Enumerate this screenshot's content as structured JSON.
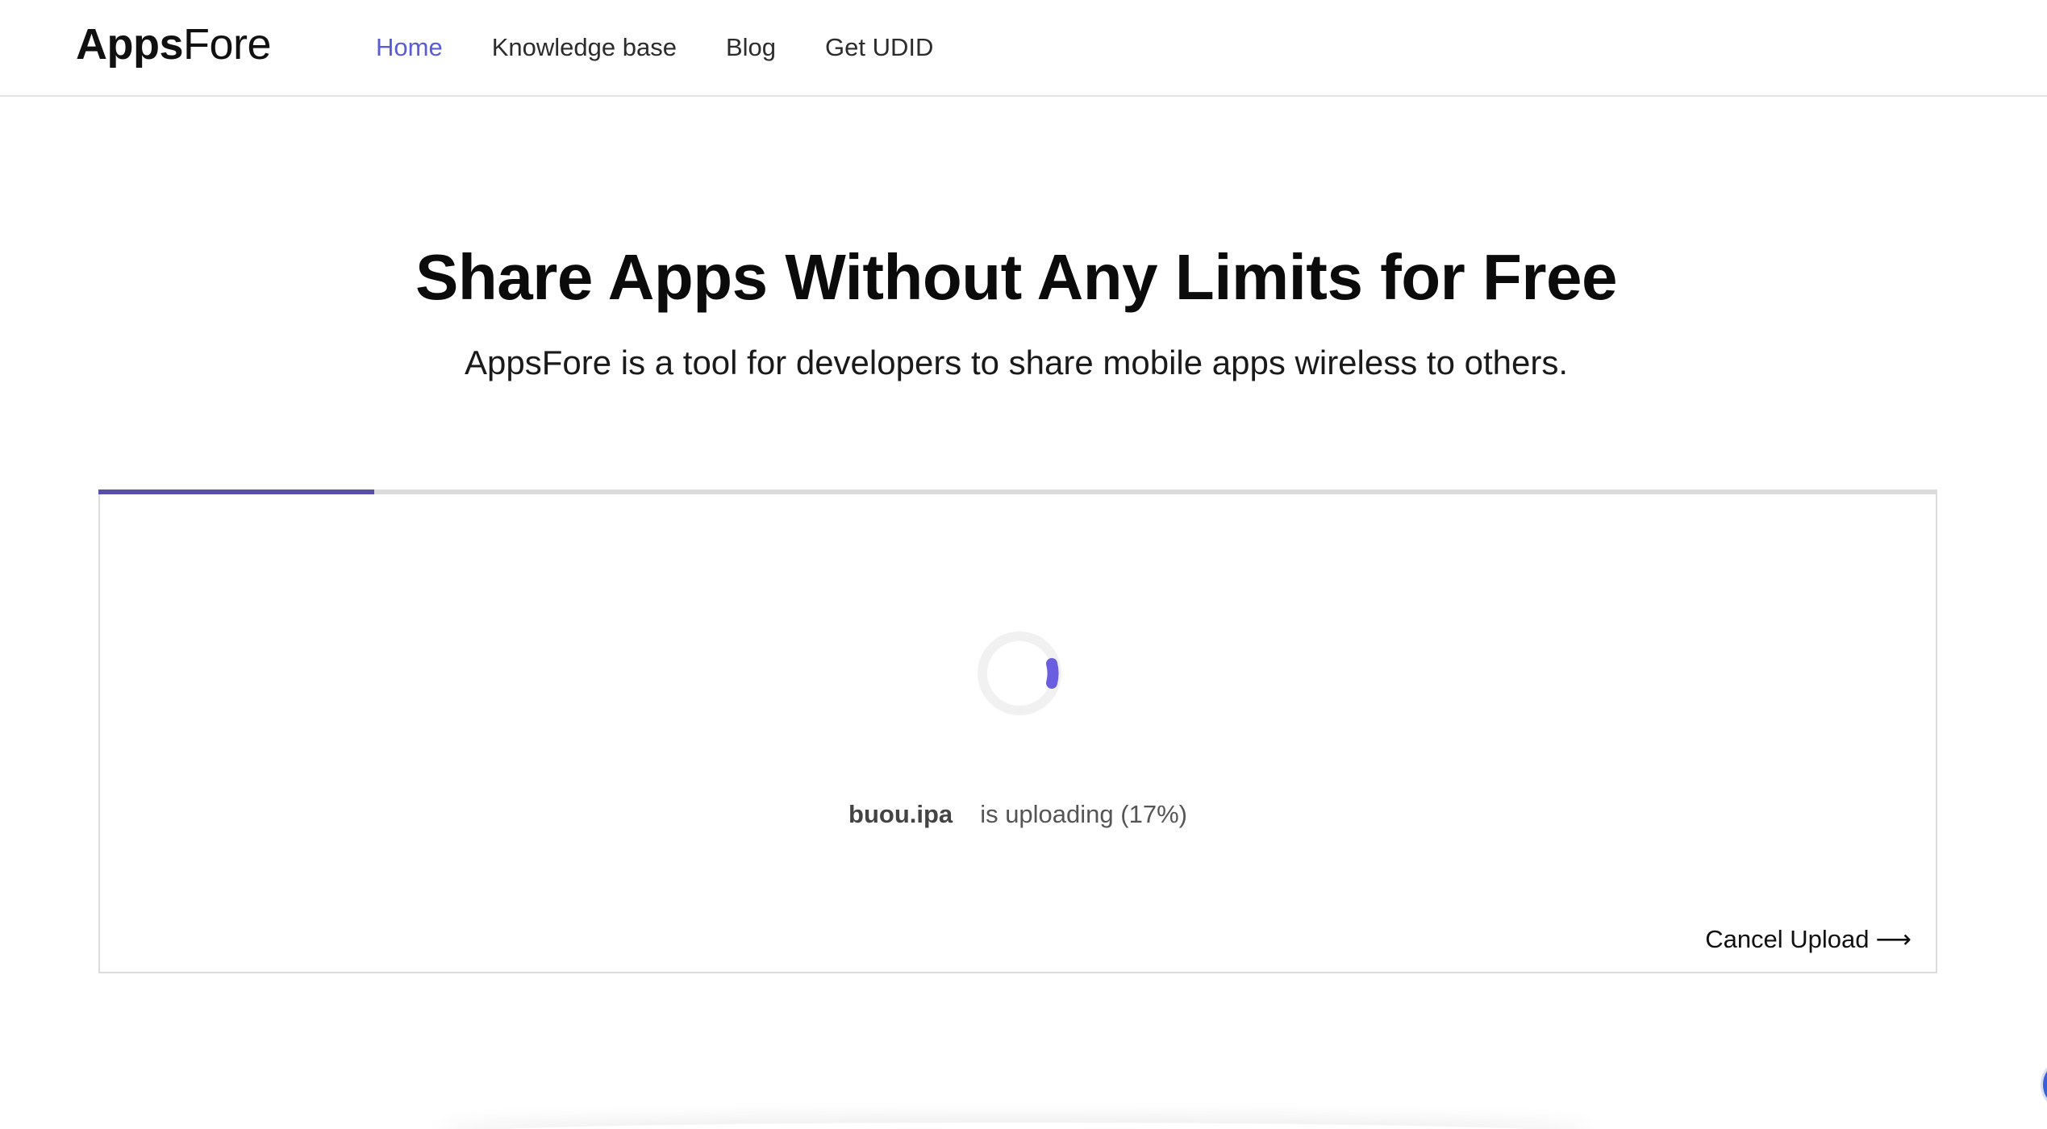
{
  "header": {
    "logo": {
      "bold": "Apps",
      "light": "Fore"
    },
    "nav": [
      {
        "label": "Home",
        "active": true
      },
      {
        "label": "Knowledge base",
        "active": false
      },
      {
        "label": "Blog",
        "active": false
      },
      {
        "label": "Get UDID",
        "active": false
      }
    ]
  },
  "hero": {
    "title": "Share Apps Without Any Limits for Free",
    "subtitle": "AppsFore is a tool for developers to share mobile apps wireless to others."
  },
  "upload": {
    "file_name": "buou.ipa",
    "status_text": "is uploading (17%)",
    "progress_fraction": 0.15,
    "cancel_label": "Cancel Upload",
    "cancel_arrow": "⟶"
  },
  "colors": {
    "accent": "#5a5cd4",
    "progress": "#574fa8",
    "spinner": "#6a5de0"
  },
  "icons": {
    "spinner": "loading-spinner-icon",
    "cancel_arrow": "arrow-right-icon"
  }
}
